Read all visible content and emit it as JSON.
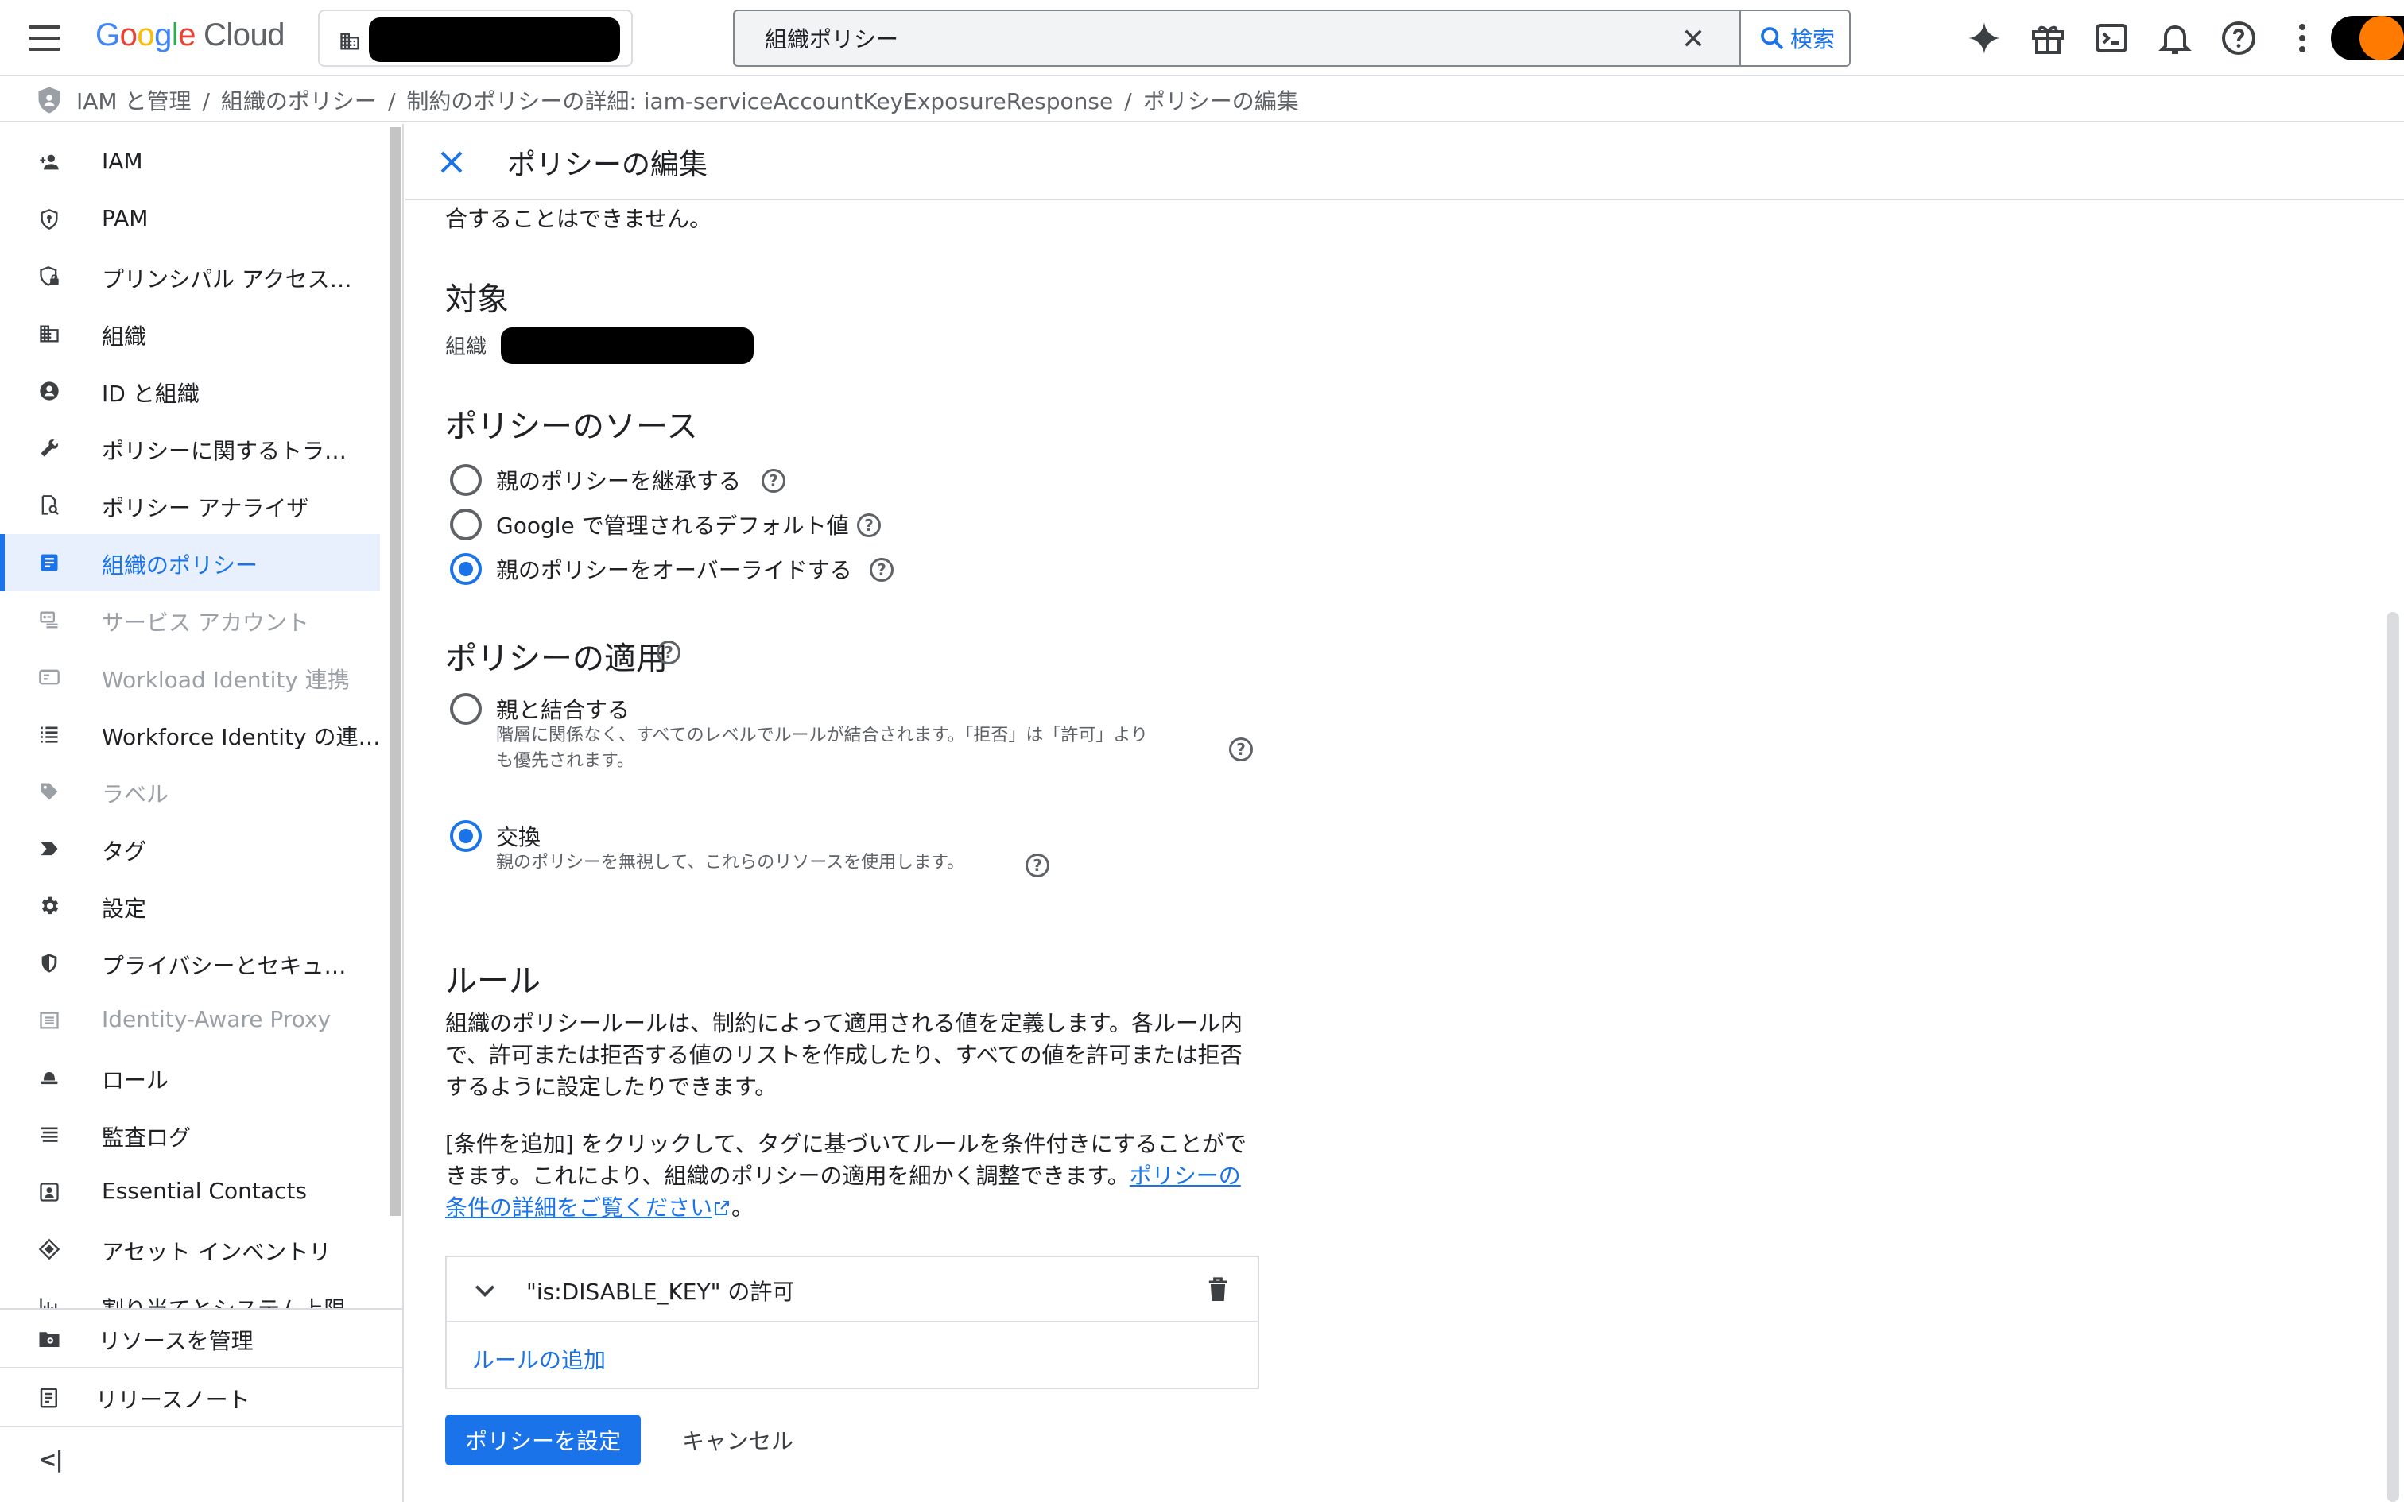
{
  "topbar": {
    "logo_letters": [
      "G",
      "o",
      "o",
      "g",
      "l",
      "e"
    ],
    "logo_cloud": "Cloud",
    "search_value": "組織ポリシー",
    "search_button": "検索"
  },
  "breadcrumb": {
    "items": [
      "IAM と管理",
      "組織のポリシー",
      "制約のポリシーの詳細: iam-serviceAccountKeyExposureResponse",
      "ポリシーの編集"
    ],
    "separator": "/"
  },
  "sidebar": {
    "items": [
      {
        "label": "IAM",
        "icon": "person-add-icon"
      },
      {
        "label": "PAM",
        "icon": "shield-key-icon"
      },
      {
        "label": "プリンシパル アクセス…",
        "icon": "shield-lock-icon"
      },
      {
        "label": "組織",
        "icon": "building-icon"
      },
      {
        "label": "ID と組織",
        "icon": "account-circle-icon"
      },
      {
        "label": "ポリシーに関するトラ…",
        "icon": "wrench-icon"
      },
      {
        "label": "ポリシー アナライザ",
        "icon": "doc-search-icon"
      },
      {
        "label": "組織のポリシー",
        "icon": "article-icon"
      },
      {
        "label": "サービス アカウント",
        "icon": "service-account-icon"
      },
      {
        "label": "Workload Identity 連携",
        "icon": "id-card-icon"
      },
      {
        "label": "Workforce Identity の連…",
        "icon": "list-icon"
      },
      {
        "label": "ラベル",
        "icon": "label-icon"
      },
      {
        "label": "タグ",
        "icon": "tag-icon"
      },
      {
        "label": "設定",
        "icon": "gear-icon"
      },
      {
        "label": "プライバシーとセキュ…",
        "icon": "shield-icon"
      },
      {
        "label": "Identity-Aware Proxy",
        "icon": "proxy-icon"
      },
      {
        "label": "ロール",
        "icon": "hat-icon"
      },
      {
        "label": "監査ログ",
        "icon": "lines-icon"
      },
      {
        "label": "Essential Contacts",
        "icon": "contact-icon"
      },
      {
        "label": "アセット インベントリ",
        "icon": "diamond-icon"
      },
      {
        "label": "割り当てとシステム上限",
        "icon": "quota-icon"
      }
    ],
    "bottom_manage": "リソースを管理",
    "bottom_notes": "リリースノート",
    "collapse_glyph": "<|"
  },
  "main": {
    "title": "ポリシーの編集",
    "cut_text": "合することはできません。",
    "target_heading": "対象",
    "target_label": "組織",
    "source_heading": "ポリシーのソース",
    "source_options": [
      "親のポリシーを継承する",
      "Google で管理されるデフォルト値",
      "親のポリシーをオーバーライドする"
    ],
    "enforce_heading": "ポリシーの適用",
    "merge_label": "親と結合する",
    "merge_desc_1": "階層に関係なく、すべてのレベルでルールが結合されます。「拒否」は「許可」より",
    "merge_desc_2": "も優先されます。",
    "replace_label": "交換",
    "replace_desc": "親のポリシーを無視して、これらのリソースを使用します。",
    "rules_heading": "ルール",
    "rules_para": "組織のポリシールールは、制約によって適用される値を定義します。各ルール内で、許可または拒否する値のリストを作成したり、すべての値を許可または拒否するように設定したりできます。",
    "cond_para": "[条件を追加] をクリックして、タグに基づいてルールを条件付きにすることができます。これにより、組織のポリシーの適用を細かく調整できます。",
    "cond_link": "ポリシーの条件の詳細をご覧ください",
    "cond_tail": "。",
    "rule_title": "\"is:DISABLE_KEY\" の許可",
    "add_rule": "ルールの追加",
    "set_policy": "ポリシーを設定",
    "cancel": "キャンセル",
    "help_glyph": "?"
  }
}
